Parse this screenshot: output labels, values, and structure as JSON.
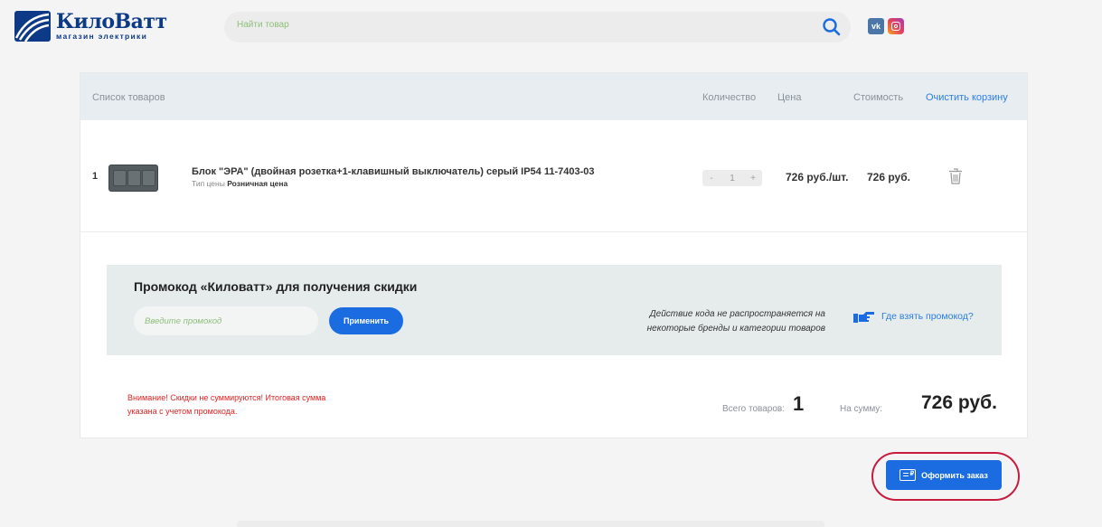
{
  "header": {
    "logo_title": "КилоВатт",
    "logo_sub": "магазин электрики",
    "search_placeholder": "Найти товар",
    "social": {
      "vk": "vk"
    }
  },
  "cart": {
    "headers": {
      "list": "Список товаров",
      "qty": "Количество",
      "price": "Цена",
      "cost": "Стоимость",
      "clear": "Очистить корзину"
    },
    "items": [
      {
        "num": "1",
        "name": "Блок \"ЭРА\" (двойная розетка+1-клавишный выключатель) серый IP54 11-7403-03",
        "price_type_label": "Тип цены",
        "price_type": "Розничная цена",
        "qty_minus": "-",
        "qty": "1",
        "qty_plus": "+",
        "unit_price": "726 руб./шт.",
        "total": "726 руб."
      }
    ]
  },
  "promo": {
    "title": "Промокод «Киловатт» для получения скидки",
    "placeholder": "Введите промокод",
    "apply": "Применить",
    "note": "Действие кода не распространяется на некоторые бренды и категории товаров",
    "where": "Где взять промокод?"
  },
  "summary": {
    "warning": "Внимание! Скидки не суммируются! Итоговая сумма указана с учетом промокода.",
    "count_label": "Всего товаров:",
    "count": "1",
    "sum_label": "На сумму:",
    "sum": "726 руб."
  },
  "checkout": {
    "label": "Оформить заказ"
  },
  "colors": {
    "accent": "#1a6ce0",
    "brand": "#0d3a86",
    "warning": "#e02424",
    "highlight": "#c71c3e"
  }
}
